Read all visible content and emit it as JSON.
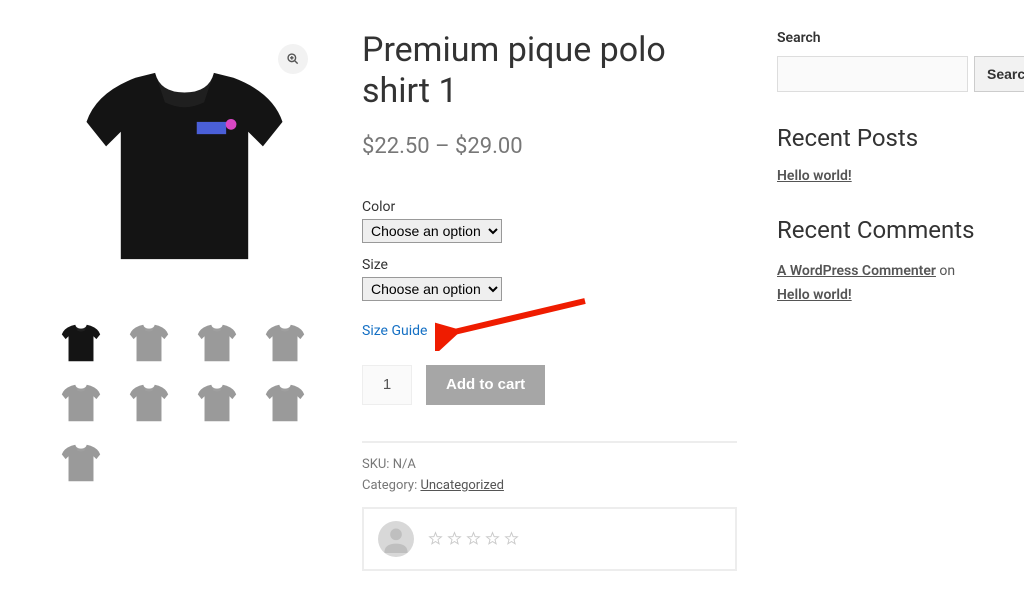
{
  "product": {
    "title": "Premium pique polo shirt 1",
    "price_text": "$22.50 – $29.00",
    "variations": {
      "color": {
        "label": "Color",
        "placeholder": "Choose an option"
      },
      "size": {
        "label": "Size",
        "placeholder": "Choose an option"
      }
    },
    "size_guide_label": "Size Guide",
    "quantity": "1",
    "add_to_cart_label": "Add to cart",
    "sku_label": "SKU:",
    "sku_value": "N/A",
    "category_label": "Category:",
    "category_value": "Uncategorized"
  },
  "gallery": {
    "thumbnail_count": 9,
    "main_color": "#141414",
    "thumb_active_color": "#141414",
    "thumb_inactive_color": "#9a9a9a"
  },
  "sidebar": {
    "search_heading": "Search",
    "search_button": "Search",
    "recent_posts_heading": "Recent Posts",
    "recent_posts": [
      "Hello world!"
    ],
    "recent_comments_heading": "Recent Comments",
    "comment_author": "A WordPress Commenter",
    "comment_on": " on ",
    "comment_post": "Hello world!"
  }
}
